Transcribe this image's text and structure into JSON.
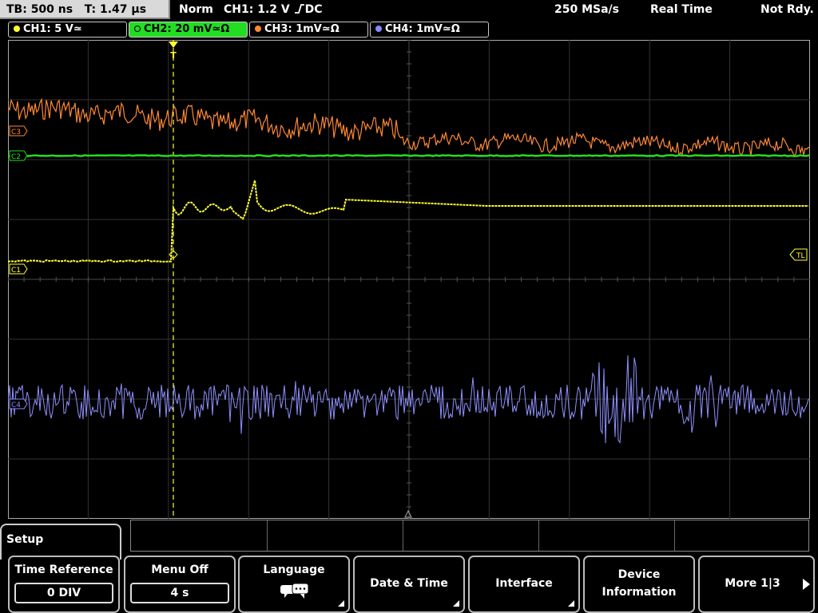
{
  "status": {
    "timebase": "TB: 500 ns",
    "time": "T: 1.47 µs",
    "trigger_mode": "Norm",
    "trigger_info": "CH1: 1.2 V",
    "trigger_coupling": "DC",
    "sample_rate": "250 MSa/s",
    "acq_mode": "Real Time",
    "state": "Not Rdy."
  },
  "channels": [
    {
      "label": "CH1: 5 V≃",
      "color": "#ffff33"
    },
    {
      "label": "CH2: 20 mV≃Ω",
      "color": "#22dd22"
    },
    {
      "label": "CH3: 1mV≃Ω",
      "color": "#ff8833"
    },
    {
      "label": "CH4: 1mV≃Ω",
      "color": "#8888ff"
    }
  ],
  "markers": {
    "c1": "C1",
    "c2": "C2",
    "c3": "C3",
    "c4": "C4",
    "tl": "TL",
    "trigger": "T"
  },
  "menu": {
    "title": "Setup",
    "softkeys": [
      {
        "label": "Time Reference",
        "value": "0 DIV"
      },
      {
        "label": "Menu Off",
        "value": "4 s"
      },
      {
        "label": "Language",
        "icon": "speech-bubble-icon"
      },
      {
        "label": "Date & Time"
      },
      {
        "label": "Interface"
      },
      {
        "label1": "Device",
        "label2": "Information"
      },
      {
        "label": "More 1|3"
      }
    ]
  },
  "colors": {
    "ch1": "#ffff33",
    "ch2": "#22dd22",
    "ch3": "#ff8833",
    "ch4": "#8888ff",
    "grid": "#3a3a3a",
    "background": "#000000"
  }
}
